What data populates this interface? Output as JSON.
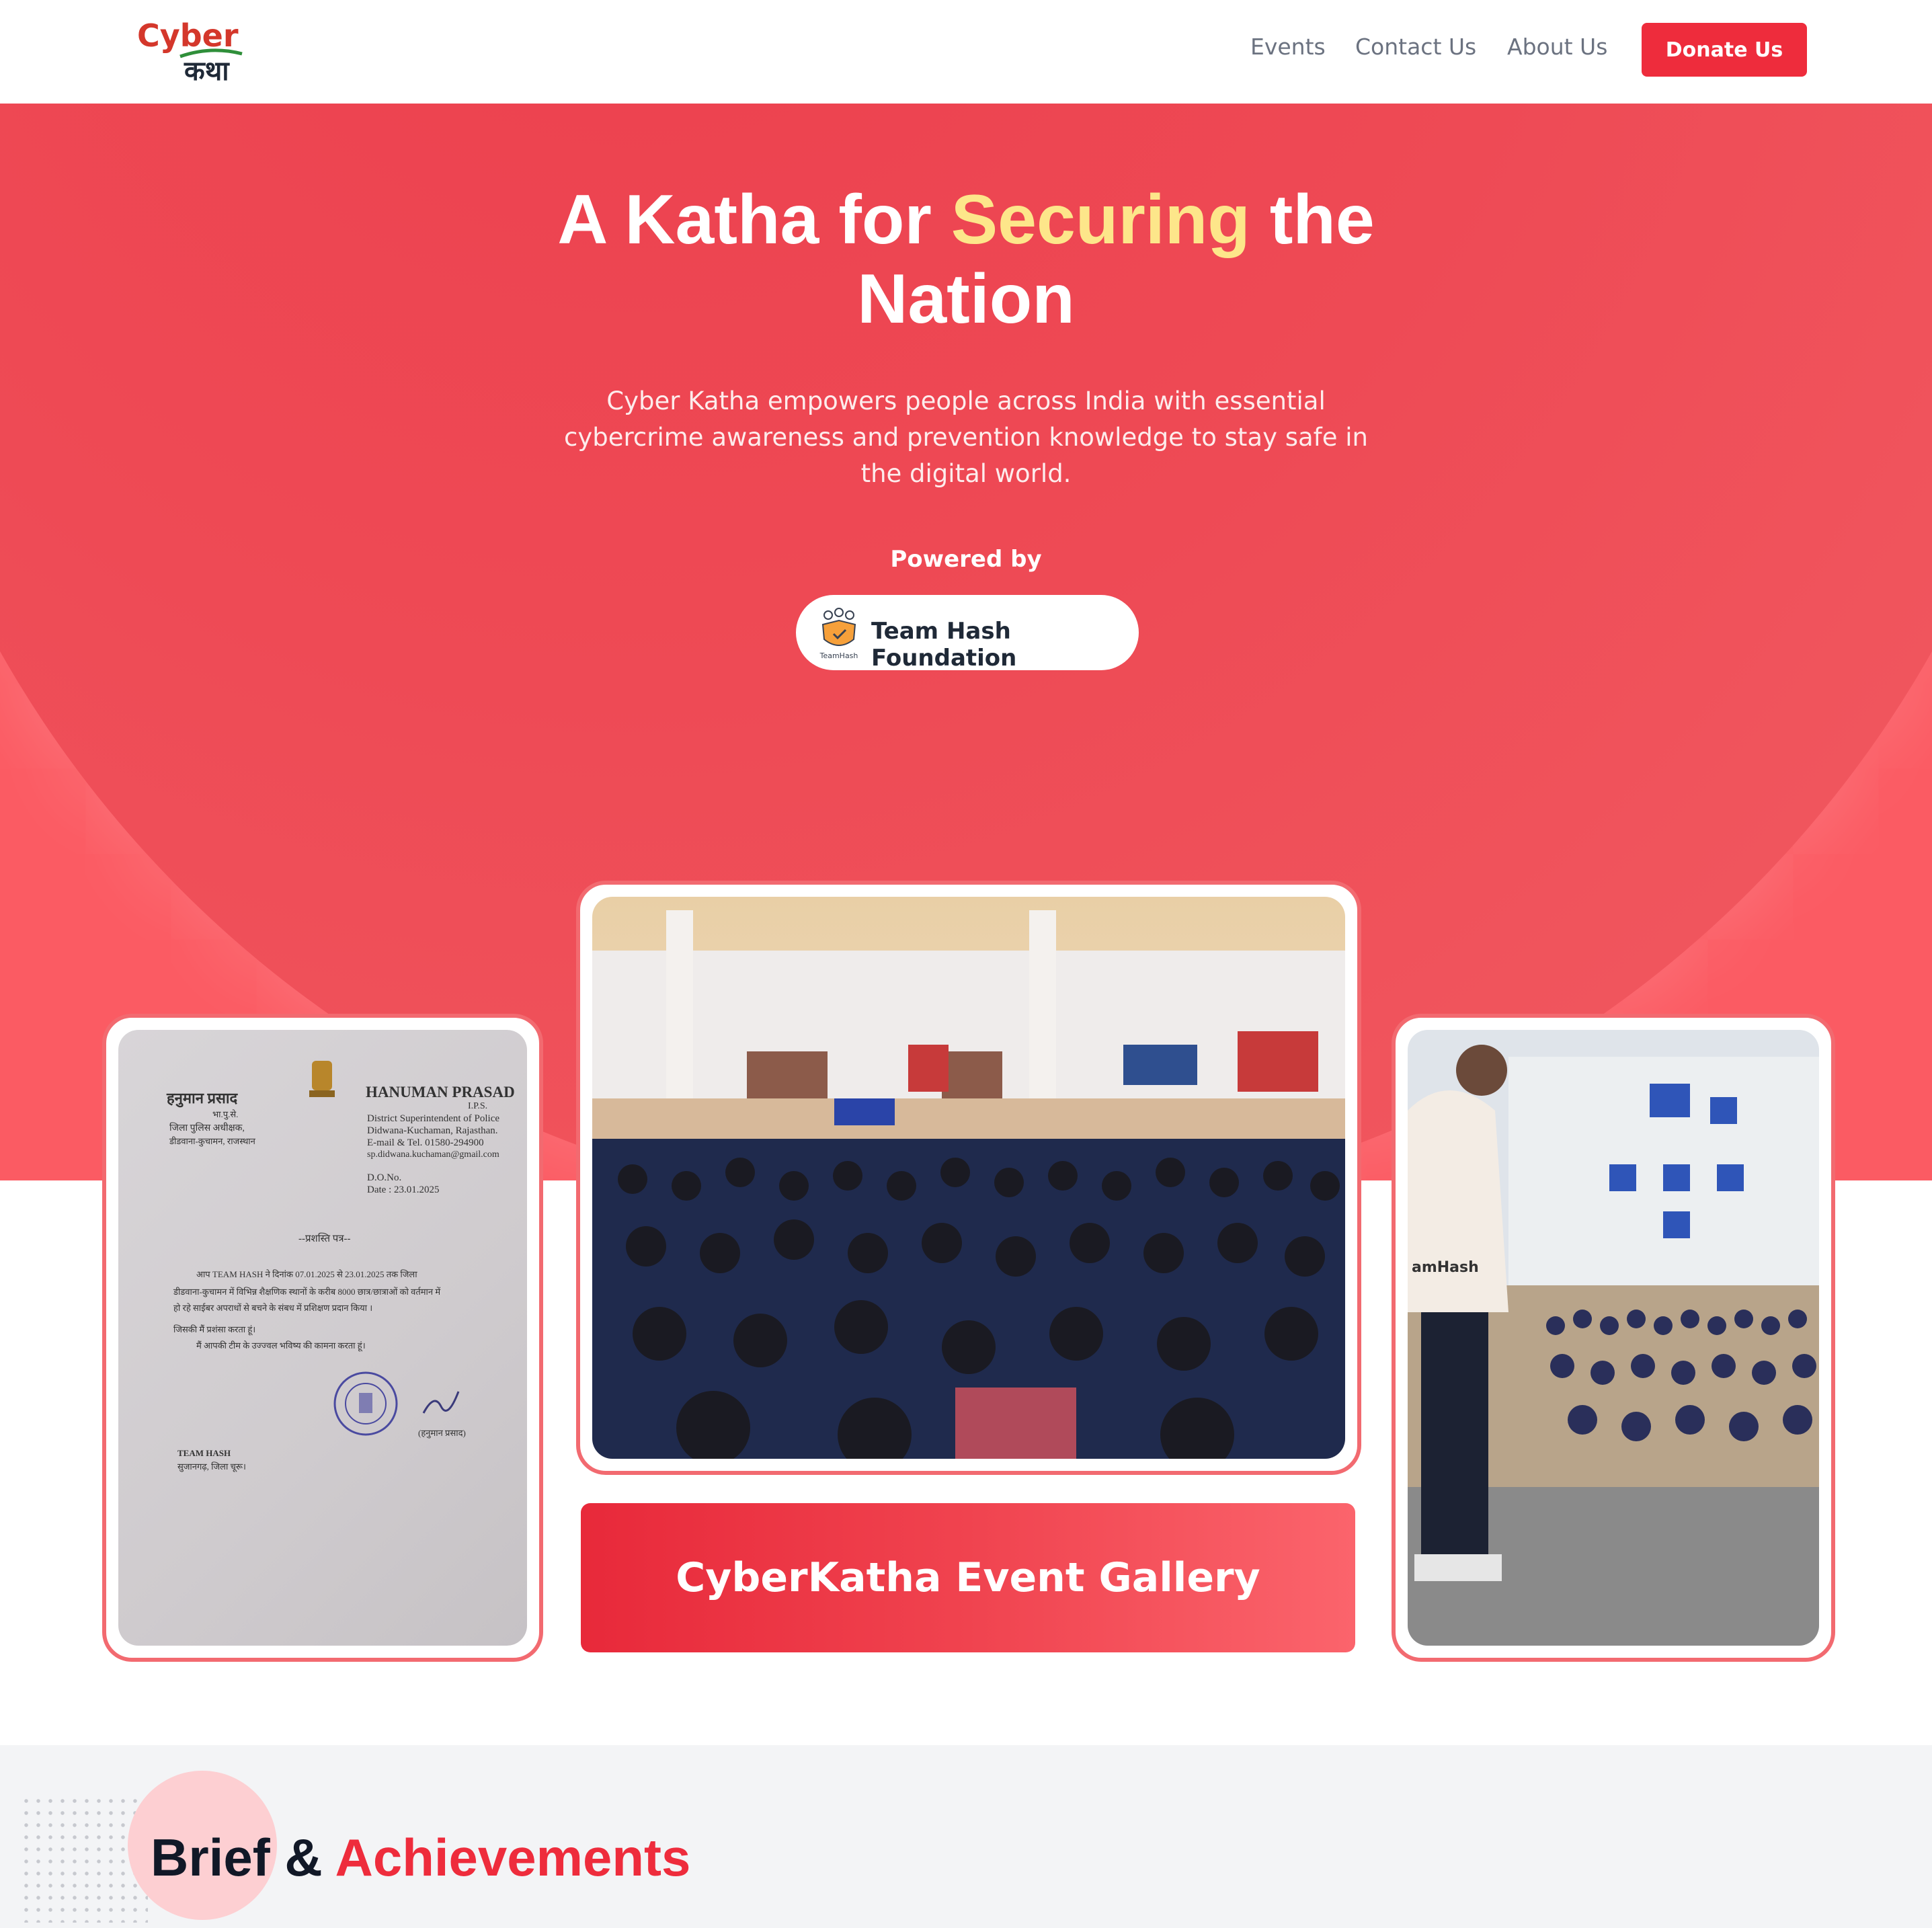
{
  "nav": {
    "logo_top": "Cyber",
    "logo_bottom": "कथा",
    "links": [
      "Events",
      "Contact Us",
      "About Us"
    ],
    "donate_label": "Donate Us"
  },
  "hero": {
    "title_part1": "A Katha for ",
    "title_highlight": "Securing",
    "title_part2": " the Nation",
    "subtitle": "Cyber Katha empowers people across India with essential cybercrime awareness and prevention knowledge to stay safe in the digital world.",
    "powered_by": "Powered by",
    "partner_name": "Team Hash Foundation",
    "partner_logo_text": "TeamHash"
  },
  "gallery": {
    "banner_label": "CyberKatha Event Gallery",
    "letter": {
      "name_hi": "हनुमान प्रसाद",
      "designation_hi": "भा.पु.से.",
      "office_hi": "जिला पुलिस अधीक्षक,",
      "place_hi": "डीडवाना-कुचामन, राजस्थान",
      "name_en": "HANUMAN PRASAD",
      "service": "I.P.S.",
      "role": "District Superintendent of Police",
      "place_en": "Didwana-Kuchaman, Rajasthan.",
      "tel": "E-mail & Tel. 01580-294900",
      "email": "sp.didwana.kuchaman@gmail.com",
      "do_no": "D.O.No.",
      "date": "Date : 23.01.2025",
      "heading": "--प्रशस्ति पत्र--",
      "body1": "आप TEAM HASH ने दिनांक 07.01.2025 से 23.01.2025 तक जिला",
      "body2": "डीडवाना-कुचामन में विभिन्न शैक्षणिक स्थानों के करीब 8000 छात्र/छात्राओं को वर्तमान में",
      "body3": "हो रहे साईबर अपराधों से बचने के संबध में प्रशिक्षण प्रदान किया ।",
      "body4": "जिसकी मैं प्रशंसा करता हूं।",
      "body5": "मैं आपकी टीम के उज्ज्वल भविष्य की कामना करता हूं।",
      "sign": "(हनुमान प्रसाद)",
      "to": "TEAM HASH",
      "to_place": "सुजानगढ़, जिला चूरू।"
    },
    "hoodie_text": "amHash"
  },
  "brief": {
    "title_part1": "Brief & ",
    "title_highlight": "Achievements"
  },
  "colors": {
    "primary_red": "#ee2c3c",
    "highlight_yellow": "#fde68a",
    "card_border": "#f26a70"
  }
}
